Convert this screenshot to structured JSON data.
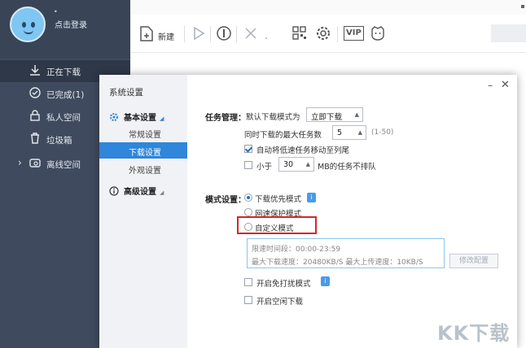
{
  "profile": {
    "dot": "•",
    "login_label": "点击登录"
  },
  "sidebar": {
    "items": [
      {
        "label": "正在下载",
        "icon": "download-icon",
        "active": true
      },
      {
        "label": "已完成(1)",
        "icon": "check-circle-icon"
      },
      {
        "label": "私人空间",
        "icon": "lock-icon"
      },
      {
        "label": "垃圾箱",
        "icon": "trash-icon"
      },
      {
        "label": "离线空间",
        "icon": "cloud-icon"
      }
    ]
  },
  "toolbar": {
    "new_label": "新建",
    "vip_label": "VIP",
    "icons": [
      "new-file-icon",
      "play-icon",
      "pause-icon",
      "delete-icon",
      "qrcode-icon",
      "settings-icon",
      "vip-icon",
      "mascot-icon"
    ]
  },
  "dialog": {
    "title": "系统设置",
    "minimize_symbol": "–",
    "close_symbol": "✕",
    "nav": {
      "basic_group": "基本设置",
      "basic_items": [
        "常规设置",
        "下载设置",
        "外观设置"
      ],
      "active_item": "下载设置",
      "advanced_group": "高级设置",
      "expand_symbol": "◢"
    },
    "task": {
      "section_label": "任务管理：",
      "default_mode_label": "默认下载模式为",
      "default_mode_value": "立即下载",
      "max_tasks_label": "同时下载的最大任务数",
      "max_tasks_value": "5",
      "max_tasks_range": "(1-50)",
      "auto_move_label": "自动将低速任务移动至列尾",
      "auto_move_checked": true,
      "small_label": "小于",
      "small_value": "30",
      "small_suffix": "MB的任务不排队",
      "small_checked": false
    },
    "mode": {
      "section_label": "模式设置：",
      "options": [
        "下载优先模式",
        "网速保护模式",
        "自定义模式"
      ],
      "selected_index": 0,
      "info_symbol": "i",
      "limit_time_label": "限速时间段：00:00-23:59",
      "limit_speed_label": "最大下载速度：20480KB/S  最大上传速度：10KB/S",
      "modify_button": "修改配置",
      "anti_disturb_label": "开启免打扰模式",
      "idle_download_label": "开启空闲下载"
    },
    "select_arrow": "▲"
  },
  "watermark": "KK下载"
}
